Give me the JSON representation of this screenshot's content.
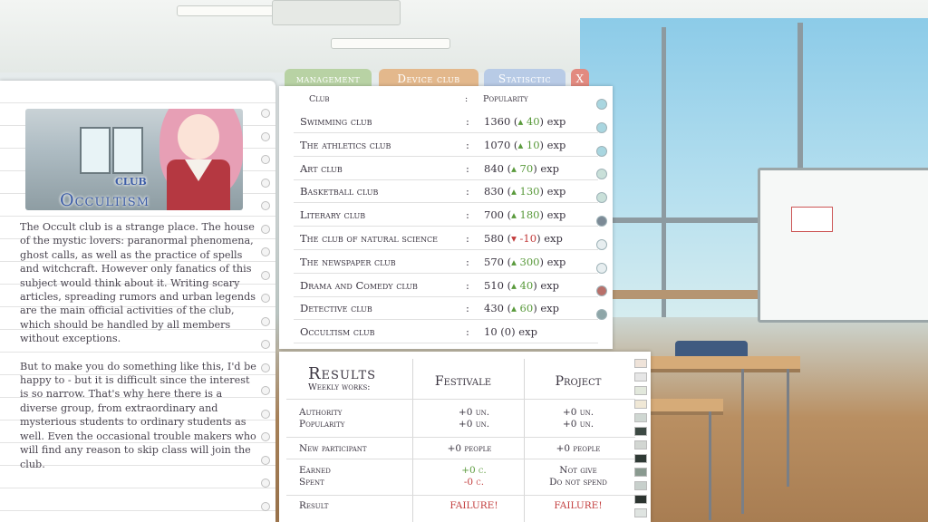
{
  "tabs": {
    "management": "management",
    "device_club": "Device club",
    "statistic": "Statisctic",
    "close": "X"
  },
  "club_card": {
    "label": "club",
    "name": "Occultism",
    "description": [
      "The Occult club is a strange place. The house of the mystic lovers: paranormal phenomena, ghost calls, as well as the practice of spells and witchcraft. However only fanatics of this subject would think about it. Writing scary articles, spreading rumors and urban legends are the main official activities of the club, which should be handled by all members without exceptions.",
      "But to make you do something like this, I'd be happy to - but it is difficult since the interest is so narrow. That's why here there is a diverse group, from extraordinary and mysterious students to ordinary students as well. Even the occasional trouble makers who will find any reason to skip class will join the club."
    ]
  },
  "club_list": {
    "header_club": "Club",
    "header_colon": ":",
    "header_popularity": "Popularity",
    "rows": [
      {
        "name": "Swimming club",
        "value": "1360",
        "delta": "40",
        "dir": "up",
        "unit": "exp",
        "dot": "#a9d6e0"
      },
      {
        "name": "The athletics club",
        "value": "1070",
        "delta": "10",
        "dir": "up",
        "unit": "exp",
        "dot": "#a9d6e0"
      },
      {
        "name": "Art club",
        "value": "840",
        "delta": "70",
        "dir": "up",
        "unit": "exp",
        "dot": "#a9d6e0"
      },
      {
        "name": "Basketball club",
        "value": "830",
        "delta": "130",
        "dir": "up",
        "unit": "exp",
        "dot": "#c9e0d9"
      },
      {
        "name": "Literary club",
        "value": "700",
        "delta": "180",
        "dir": "up",
        "unit": "exp",
        "dot": "#c9e0d9"
      },
      {
        "name": "The club of natural science",
        "value": "580",
        "delta": "-10",
        "dir": "down",
        "unit": "exp",
        "dot": "#7c8a96"
      },
      {
        "name": "The newspaper club",
        "value": "570",
        "delta": "300",
        "dir": "up",
        "unit": "exp",
        "dot": "#e7eef0"
      },
      {
        "name": "Drama and Comedy club",
        "value": "510",
        "delta": "40",
        "dir": "up",
        "unit": "exp",
        "dot": "#e7eef0"
      },
      {
        "name": "Detective club",
        "value": "430",
        "delta": "60",
        "dir": "up",
        "unit": "exp",
        "dot": "#b8706a"
      },
      {
        "name": "Occultism club",
        "value": "10",
        "delta": "0",
        "dir": "none",
        "unit": "exp",
        "dot": "#8ea6a8"
      }
    ]
  },
  "results": {
    "title": "Results",
    "subtitle": "Weekly works:",
    "col_festival": "Festivale",
    "col_project": "Project",
    "rows": {
      "authority_label": "Authority",
      "popularity_label": "Popularity",
      "authority_festival": "+0 un.",
      "popularity_festival": "+0 un.",
      "authority_project": "+0 un.",
      "popularity_project": "+0 un.",
      "participant_label": "New participant",
      "participant_festival": "+0 people",
      "participant_project": "+0 people",
      "earned_label": "Earned",
      "spent_label": "Spent",
      "earned_festival": "+0 c.",
      "spent_festival": "-0 c.",
      "earned_project": "Not give",
      "spent_project": "Do not spend",
      "result_label": "Result",
      "result_festival": "FAILURE!",
      "result_project": "FAILURE!"
    }
  },
  "colors": {
    "title_blue": "#3d5da6",
    "delta_up": "#5a9a3c",
    "delta_down": "#c23c3c"
  }
}
